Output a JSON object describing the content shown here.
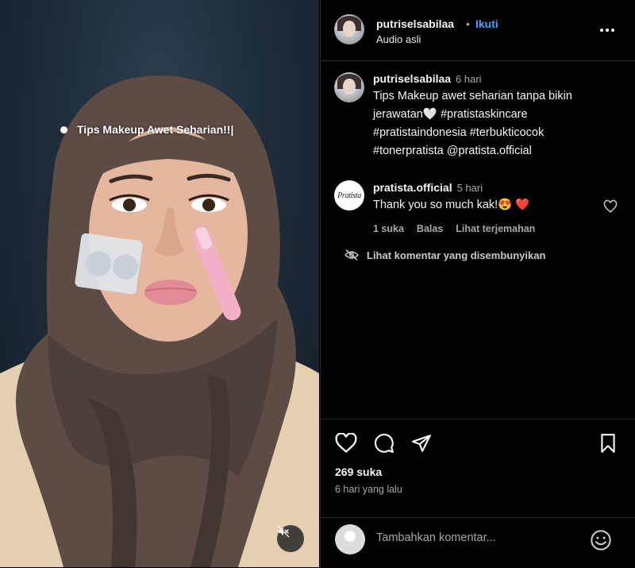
{
  "media": {
    "overlay_text": "Tips Makeup Awet Seharian!!|"
  },
  "header": {
    "username": "putriselsabilaa",
    "separator": "•",
    "follow_label": "Ikuti",
    "subtitle": "Audio asli"
  },
  "caption": {
    "username": "putriselsabilaa",
    "time": "6 hari",
    "line1": "Tips Makeup awet seharian tanpa bikin",
    "line2": "jerawatan🤍 #pratistaskincare",
    "line3": "#pratistaindonesia #terbukticocok",
    "line4": "#tonerpratista @pratista.official"
  },
  "reply": {
    "avatar_text": "Pratista",
    "username": "pratista.official",
    "time": "5 hari",
    "text": "Thank you so much kak!😍 ❤️",
    "likes_label": "1 suka",
    "reply_label": "Balas",
    "translate_label": "Lihat terjemahan"
  },
  "hidden_comments_label": "Lihat komentar yang disembunyikan",
  "post": {
    "likes": "269 suka",
    "date": "6 hari yang lalu"
  },
  "add_comment": {
    "placeholder": "Tambahkan komentar..."
  },
  "colors": {
    "background": "#000000",
    "accent": "#4c9fff",
    "muted": "#a8a8a8",
    "heart": "#ed4956"
  }
}
